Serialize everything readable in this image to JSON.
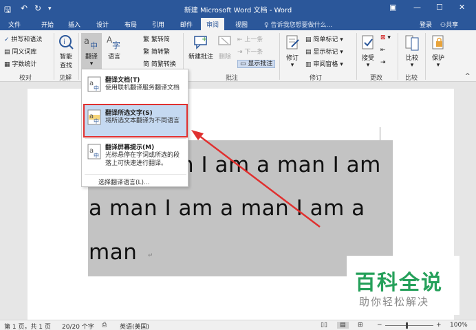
{
  "titlebar": {
    "title": "新建 Microsoft Word 文档 - Word",
    "quick_access": {
      "save": "🖫",
      "undo": "↶",
      "redo": "↻",
      "customize": "▾"
    },
    "window_buttons": {
      "ribbon_options": "▣",
      "minimize": "—",
      "maximize": "☐",
      "close": "✕"
    }
  },
  "tabs": [
    {
      "label": "文件"
    },
    {
      "label": "开始"
    },
    {
      "label": "插入"
    },
    {
      "label": "设计"
    },
    {
      "label": "布局"
    },
    {
      "label": "引用"
    },
    {
      "label": "邮件"
    },
    {
      "label": "审阅",
      "active": true
    },
    {
      "label": "视图"
    }
  ],
  "tell_me": "告诉我您想要做什么...",
  "account": {
    "login": "登录",
    "share": "共享"
  },
  "ribbon": {
    "proofing": {
      "spelling": "拼写和语法",
      "thesaurus": "同义词库",
      "wordcount": "字数统计",
      "group": "校对"
    },
    "insights": {
      "smart_lookup_1": "智能",
      "smart_lookup_2": "查找",
      "group": "见解"
    },
    "language": {
      "translate": "翻译",
      "language": "语言"
    },
    "chinese": {
      "to_simplified": "繁转简",
      "to_traditional": "简转繁",
      "convert": "简繁转换"
    },
    "comments": {
      "new": "新建批注",
      "delete": "删除",
      "previous": "上一条",
      "next": "下一条",
      "show": "显示批注",
      "group": "批注"
    },
    "tracking": {
      "track": "修订",
      "markup": "简单标记",
      "show_markup": "显示标记",
      "reviewing_pane": "审阅窗格",
      "group": "修订"
    },
    "changes": {
      "accept": "接受",
      "group": "更改"
    },
    "compare": {
      "compare": "比较",
      "group": "比较"
    },
    "protect": {
      "protect": "保护"
    }
  },
  "translate_menu": {
    "items": [
      {
        "title": "翻译文档(T)",
        "desc": "使用联机翻译服务翻译文档"
      },
      {
        "title": "翻译所选文字(S)",
        "desc": "将所选文本翻译为不同语言",
        "highlighted": true
      },
      {
        "title": "翻译屏幕提示(M)",
        "desc": "光标悬停在字词或所选的段落上可快速进行翻译。"
      }
    ],
    "footer": "选择翻译语言(L)..."
  },
  "document": {
    "line1": "n I am a man I am",
    "line2": "a  man  I  am  a  man  I  am  a",
    "line3": "man",
    "para_mark": "↵"
  },
  "statusbar": {
    "page": "第 1 页，共 1 页",
    "words": "20/20 个字",
    "language": "英语(美国)",
    "zoom": "100%"
  },
  "watermark": {
    "main": "百科全说",
    "sub": "助你轻松解决"
  },
  "colors": {
    "brand": "#2b579a",
    "highlight_outline": "#e0302f",
    "arrow": "#e0302f",
    "watermark": "#25a05a"
  }
}
